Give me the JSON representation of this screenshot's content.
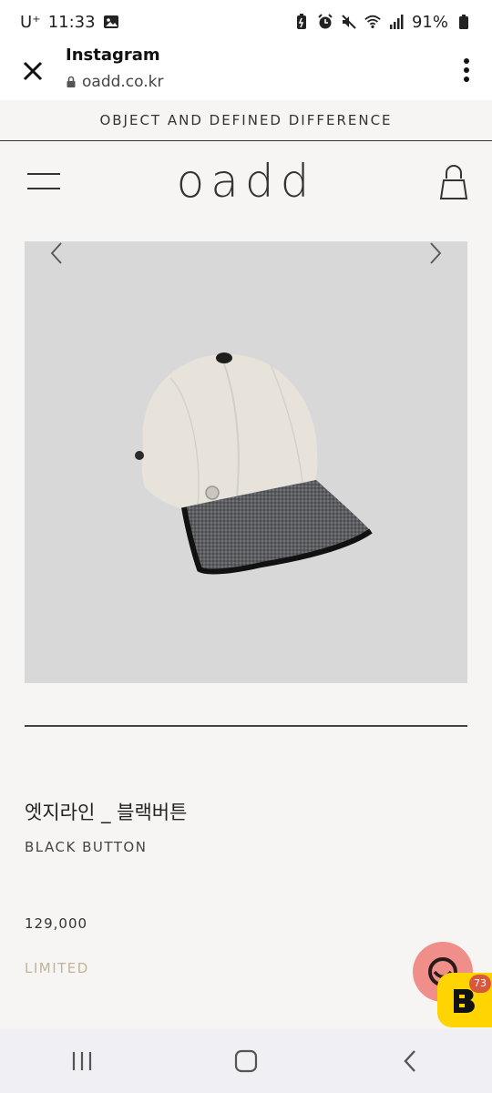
{
  "status_bar": {
    "carrier": "U⁺",
    "time": "11:33",
    "battery": "91%"
  },
  "browser": {
    "title": "Instagram",
    "url": "oadd.co.kr"
  },
  "banner": {
    "text": "OBJECT AND DEFINED DIFFERENCE"
  },
  "site": {
    "logo": "oadd"
  },
  "product": {
    "name_ko": "엣지라인 _ 블랙버튼",
    "name_en": "BLACK BUTTON",
    "price": "129,000",
    "tag": "LIMITED"
  },
  "widgets": {
    "badge_count": "73"
  },
  "colors": {
    "background": "#f7f5f3",
    "hero_bg": "#d8d8d8",
    "limited": "#bfb39a",
    "chat_button": "#f08f8a",
    "bunjang_yellow": "#ffd400"
  }
}
